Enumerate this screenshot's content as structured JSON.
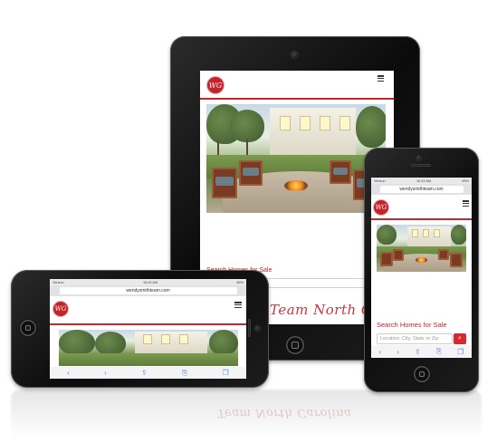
{
  "site": {
    "logo_text": "WG",
    "search_title": "Search Homes for Sale",
    "search_placeholder": "Location: City, State or Zip",
    "search_button_icon": "search-icon",
    "search_button_glyph": "⌕",
    "tagline_script": "Team North Carolina",
    "reflection_script": "Team North Carolina"
  },
  "browser": {
    "url": "wendysmithteam.com",
    "carrier": "Verizon",
    "phone_time": "10:43 AM",
    "landscape_time": "10:43 AM",
    "battery": "85%",
    "toolbar_icons": [
      "back-icon",
      "forward-icon",
      "share-icon",
      "bookmarks-icon",
      "tabs-icon"
    ],
    "toolbar_glyphs": [
      "‹",
      "›",
      "⇪",
      "⎘",
      "❐"
    ]
  },
  "colors": {
    "brand_red": "#c42329",
    "device_black": "#111111",
    "ios_blue": "#5a8ad0"
  }
}
